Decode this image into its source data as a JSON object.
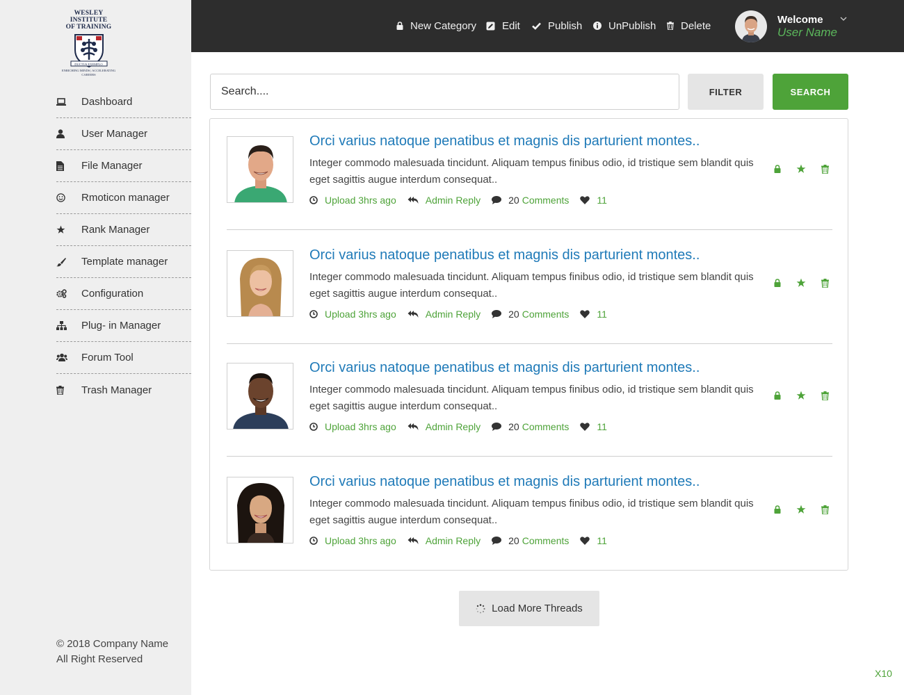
{
  "logo": {
    "line1": "WESLEY INSTITUTE",
    "line2": "OF TRAINING",
    "motto": "DUCTUS EXEMPLO",
    "tagline": "ENRICHING MINDS | ACCELERATING CAREERS"
  },
  "sidebar": {
    "items": [
      {
        "label": "Dashboard",
        "icon": "laptop-icon"
      },
      {
        "label": "User Manager",
        "icon": "user-icon"
      },
      {
        "label": "File Manager",
        "icon": "file-icon"
      },
      {
        "label": "Rmoticon manager",
        "icon": "smile-icon"
      },
      {
        "label": "Rank Manager",
        "icon": "star-icon"
      },
      {
        "label": "Template manager",
        "icon": "brush-icon"
      },
      {
        "label": "Configuration",
        "icon": "cogs-icon"
      },
      {
        "label": "Plug- in Manager",
        "icon": "sitemap-icon"
      },
      {
        "label": "Forum Tool",
        "icon": "users-icon"
      },
      {
        "label": "Trash Manager",
        "icon": "trash-icon"
      }
    ],
    "copyright_line1": "© 2018 Company Name",
    "copyright_line2": "All Right Reserved"
  },
  "topbar": {
    "new_category": "New Category",
    "edit": "Edit",
    "publish": "Publish",
    "unpublish": "UnPublish",
    "delete": "Delete",
    "welcome": "Welcome",
    "username": "User Name"
  },
  "search": {
    "placeholder": "Search....",
    "filter_label": "FILTER",
    "search_label": "SEARCH"
  },
  "threads": [
    {
      "title": "Orci varius natoque penatibus et magnis dis parturient montes..",
      "excerpt": "Integer commodo malesuada tincidunt. Aliquam tempus finibus odio, id tristique sem blandit quis eget  sagittis augue interdum consequat..",
      "upload": "Upload 3hrs ago",
      "reply": "Admin Reply",
      "comment_count": "20",
      "comments_label": "Comments",
      "likes": "11"
    },
    {
      "title": "Orci varius natoque penatibus et magnis dis parturient montes..",
      "excerpt": "Integer commodo malesuada tincidunt. Aliquam tempus finibus odio, id tristique sem blandit quis eget  sagittis augue interdum consequat..",
      "upload": "Upload 3hrs ago",
      "reply": "Admin Reply",
      "comment_count": "20",
      "comments_label": "Comments",
      "likes": "11"
    },
    {
      "title": "Orci varius natoque penatibus et magnis dis parturient montes..",
      "excerpt": "Integer commodo malesuada tincidunt. Aliquam tempus finibus odio, id tristique sem blandit quis eget  sagittis augue interdum consequat..",
      "upload": "Upload 3hrs ago",
      "reply": "Admin Reply",
      "comment_count": "20",
      "comments_label": "Comments",
      "likes": "11"
    },
    {
      "title": "Orci varius natoque penatibus et magnis dis parturient montes..",
      "excerpt": "Integer commodo malesuada tincidunt. Aliquam tempus finibus odio, id tristique sem blandit quis eget  sagittis augue interdum consequat..",
      "upload": "Upload 3hrs ago",
      "reply": "Admin Reply",
      "comment_count": "20",
      "comments_label": "Comments",
      "likes": "11"
    }
  ],
  "load_more": "Load More Threads",
  "zoom_badge": "X10",
  "colors": {
    "accent_green": "#4ea339",
    "title_blue": "#1f7ab8",
    "topbar_bg": "#2d2d2d",
    "sidebar_bg": "#efefef"
  }
}
